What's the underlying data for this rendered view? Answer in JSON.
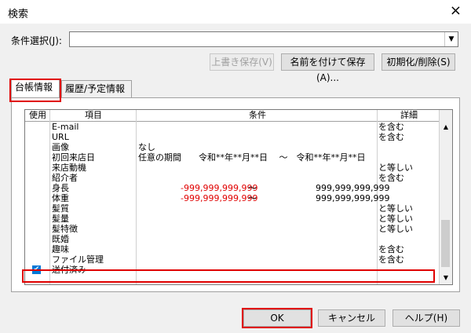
{
  "window": {
    "title": "検索",
    "close_icon": "×"
  },
  "condition_select": {
    "label": "条件選択(J):",
    "value": ""
  },
  "toolbar": {
    "overwrite": "上書き保存(V)",
    "save_as": "名前を付けて保存(A)...",
    "reset": "初期化/削除(S)"
  },
  "tabs": [
    {
      "label": "台帳情報"
    },
    {
      "label": "履歴/予定情報"
    }
  ],
  "grid": {
    "headers": {
      "use": "使用",
      "item": "項目",
      "cond": "条件",
      "detail": "詳細"
    },
    "rows": [
      {
        "item": "E-mail",
        "cond": "",
        "detail": "を含む",
        "checked": false
      },
      {
        "item": "URL",
        "cond": "",
        "detail": "を含む",
        "checked": false
      },
      {
        "item": "画像",
        "cond": "なし",
        "detail": "",
        "checked": false
      },
      {
        "item": "初回来店日",
        "cond": "任意の期間　　令和**年**月**日　 ～　令和**年**月**日",
        "detail": "",
        "checked": false
      },
      {
        "item": "来店動機",
        "cond": "",
        "detail": "と等しい",
        "checked": false
      },
      {
        "item": "紹介者",
        "cond": "",
        "detail": "を含む",
        "checked": false
      },
      {
        "item": "身長",
        "cond_min": "-999,999,999,999",
        "tilde": "～",
        "cond_max": "999,999,999,999",
        "detail": "",
        "checked": false
      },
      {
        "item": "体重",
        "cond_min": "-999,999,999,999",
        "tilde": "～",
        "cond_max": "999,999,999,999",
        "detail": "",
        "checked": false
      },
      {
        "item": "髪質",
        "cond": "",
        "detail": "と等しい",
        "checked": false
      },
      {
        "item": "髪量",
        "cond": "",
        "detail": "と等しい",
        "checked": false
      },
      {
        "item": "髪特徴",
        "cond": "",
        "detail": "と等しい",
        "checked": false
      },
      {
        "item": "既婚",
        "cond": "",
        "detail": "",
        "checked": false
      },
      {
        "item": "趣味",
        "cond": "",
        "detail": "を含む",
        "checked": false
      },
      {
        "item": "ファイル管理",
        "cond": "",
        "detail": "を含む",
        "checked": false
      },
      {
        "item": "送付済み",
        "cond": "",
        "detail": "",
        "checked": true
      }
    ]
  },
  "buttons": {
    "ok": "OK",
    "cancel": "キャンセル",
    "help": "ヘルプ(H)"
  },
  "colors": {
    "highlight": "#e00000",
    "check": "#0078d7"
  }
}
